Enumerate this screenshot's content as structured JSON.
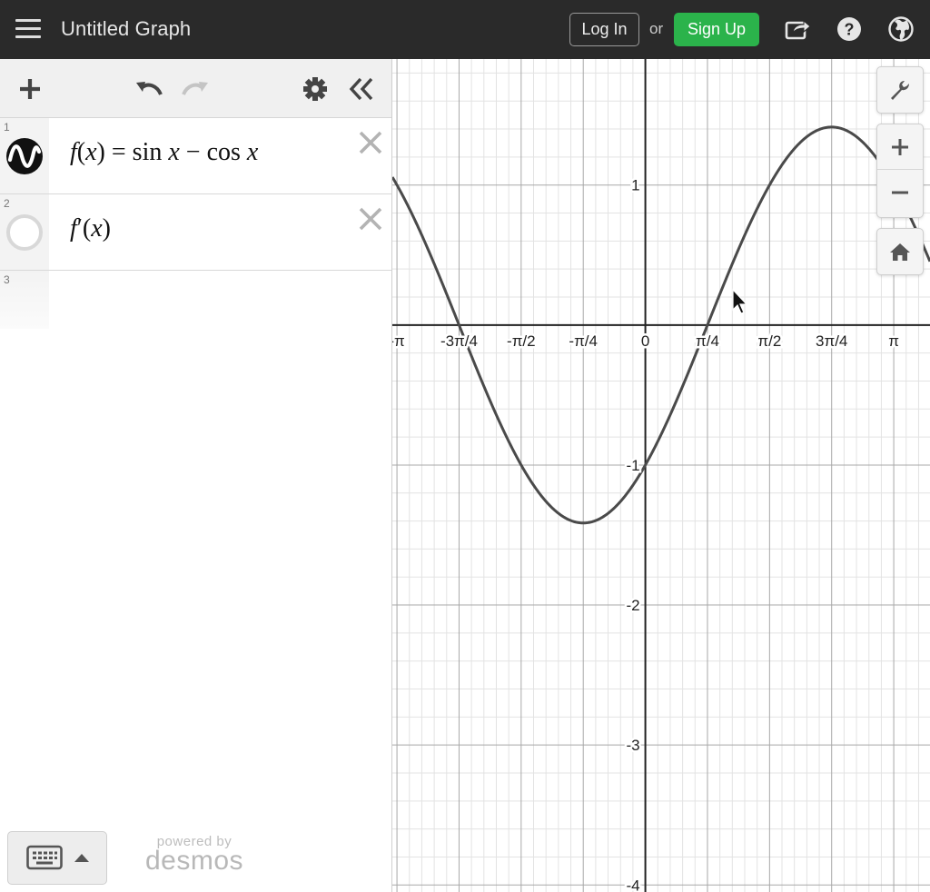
{
  "header": {
    "title": "Untitled Graph",
    "login_label": "Log In",
    "or_label": "or",
    "signup_label": "Sign Up",
    "icons": [
      "menu-icon",
      "share-icon",
      "help-icon",
      "globe-icon"
    ],
    "colors": {
      "bar": "#2a2a2a",
      "signup": "#2bb34b"
    }
  },
  "toolbar": {
    "icons": [
      "plus-icon",
      "undo-icon",
      "redo-icon",
      "gear-icon",
      "double-chevron-left-icon"
    ]
  },
  "expressions": [
    {
      "index": "1",
      "f": "f",
      "lp": "(",
      "x1": "x",
      "rp": ")",
      "eq": " = sin ",
      "x2": "x",
      "minus": " − cos ",
      "x3": "x"
    },
    {
      "index": "2",
      "f": "f",
      "prime": "′",
      "lp": "(",
      "x1": "x",
      "rp": ")"
    },
    {
      "index": "3"
    }
  ],
  "footer": {
    "powered_by": "powered by",
    "brand": "desmos"
  },
  "graph": {
    "x_ticks": [
      "-π",
      "-3π/4",
      "-π/2",
      "-π/4",
      "0",
      "π/4",
      "π/2",
      "3π/4",
      "π"
    ],
    "y_ticks": [
      "1",
      "-1",
      "-2",
      "-3",
      "-4"
    ],
    "curve_color": "#4a4a4a",
    "controls": [
      "wrench-icon",
      "zoom-in-icon",
      "zoom-out-icon",
      "home-icon"
    ]
  },
  "chart_data": {
    "type": "line",
    "series": [
      {
        "name": "",
        "function": "sin x − cos x"
      }
    ],
    "xlim": [
      -3.2,
      3.6
    ],
    "ylim": [
      -4.05,
      1.9
    ],
    "x_tick_values": [
      -3.14159,
      -2.35619,
      -1.5708,
      -0.7854,
      0,
      0.7854,
      1.5708,
      2.35619,
      3.14159
    ],
    "y_tick_values": [
      1,
      -1,
      -2,
      -3,
      -4
    ],
    "grid": true
  }
}
